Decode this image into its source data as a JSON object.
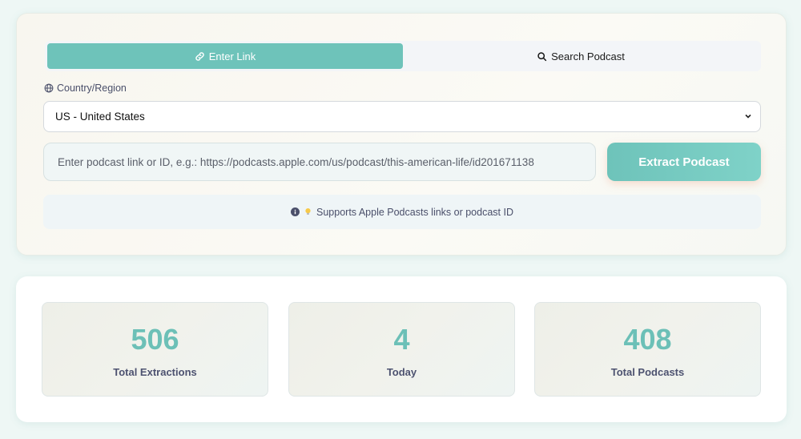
{
  "tabs": [
    {
      "label": "Enter Link",
      "icon": "link-icon",
      "active": true
    },
    {
      "label": "Search Podcast",
      "icon": "search-icon",
      "active": false
    }
  ],
  "country": {
    "label": "Country/Region",
    "icon": "globe-icon",
    "selected": "US - United States"
  },
  "link_input": {
    "placeholder": "Enter podcast link or ID, e.g.: https://podcasts.apple.com/us/podcast/this-american-life/id201671138"
  },
  "extract_button": {
    "label": "Extract Podcast"
  },
  "hint": {
    "text": "Supports Apple Podcasts links or podcast ID",
    "icons": [
      "info-icon",
      "lightbulb-icon"
    ]
  },
  "stats": [
    {
      "value": "506",
      "label": "Total Extractions"
    },
    {
      "value": "4",
      "label": "Today"
    },
    {
      "value": "408",
      "label": "Total Podcasts"
    }
  ],
  "colors": {
    "accent": "#6ec3ba",
    "stat_number": "#6cc0b7",
    "label_text": "#4d5270"
  }
}
